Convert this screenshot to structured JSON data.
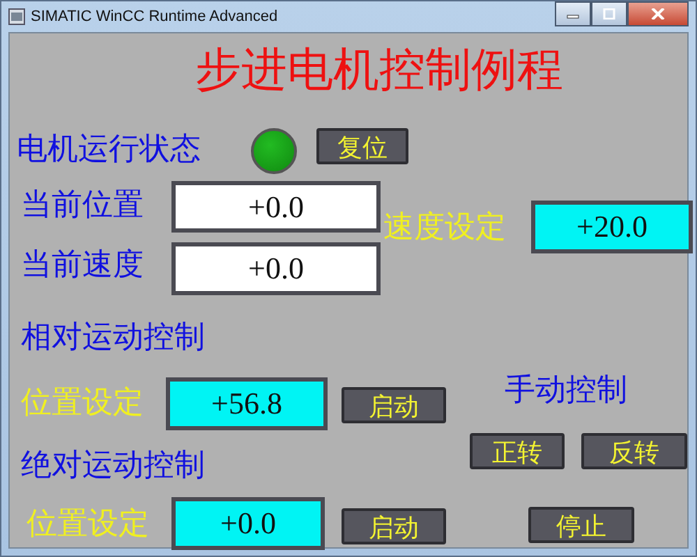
{
  "window": {
    "title": "SIMATIC WinCC Runtime Advanced"
  },
  "screen": {
    "title": "步进电机控制例程",
    "items": [
      {
        "kind": "label",
        "text": "电机运行状态",
        "color": "#1010e0"
      },
      {
        "kind": "lamp",
        "on": true
      },
      {
        "kind": "button",
        "text": "复位"
      },
      {
        "kind": "label",
        "text": "当前位置",
        "color": "#1010e0"
      },
      {
        "kind": "output",
        "text": "+0.0"
      },
      {
        "kind": "label",
        "text": "速度设定",
        "color": "#f0f020"
      },
      {
        "kind": "input",
        "text": "+20.0"
      },
      {
        "kind": "label",
        "text": "当前速度",
        "color": "#1010e0"
      },
      {
        "kind": "output",
        "text": "+0.0"
      },
      {
        "kind": "label",
        "text": "相对运动控制",
        "color": "#1010e0"
      },
      {
        "kind": "label",
        "text": "位置设定",
        "color": "#f0f020"
      },
      {
        "kind": "input",
        "text": "+56.8"
      },
      {
        "kind": "button",
        "text": "启动"
      },
      {
        "kind": "label",
        "text": "手动控制",
        "color": "#1010e0"
      },
      {
        "kind": "label",
        "text": "绝对运动控制",
        "color": "#1010e0"
      },
      {
        "kind": "button",
        "text": "正转"
      },
      {
        "kind": "button",
        "text": "反转"
      },
      {
        "kind": "label",
        "text": "位置设定",
        "color": "#f0f020"
      },
      {
        "kind": "input",
        "text": "+0.0"
      },
      {
        "kind": "button",
        "text": "启动"
      },
      {
        "kind": "button",
        "text": "停止"
      }
    ]
  }
}
